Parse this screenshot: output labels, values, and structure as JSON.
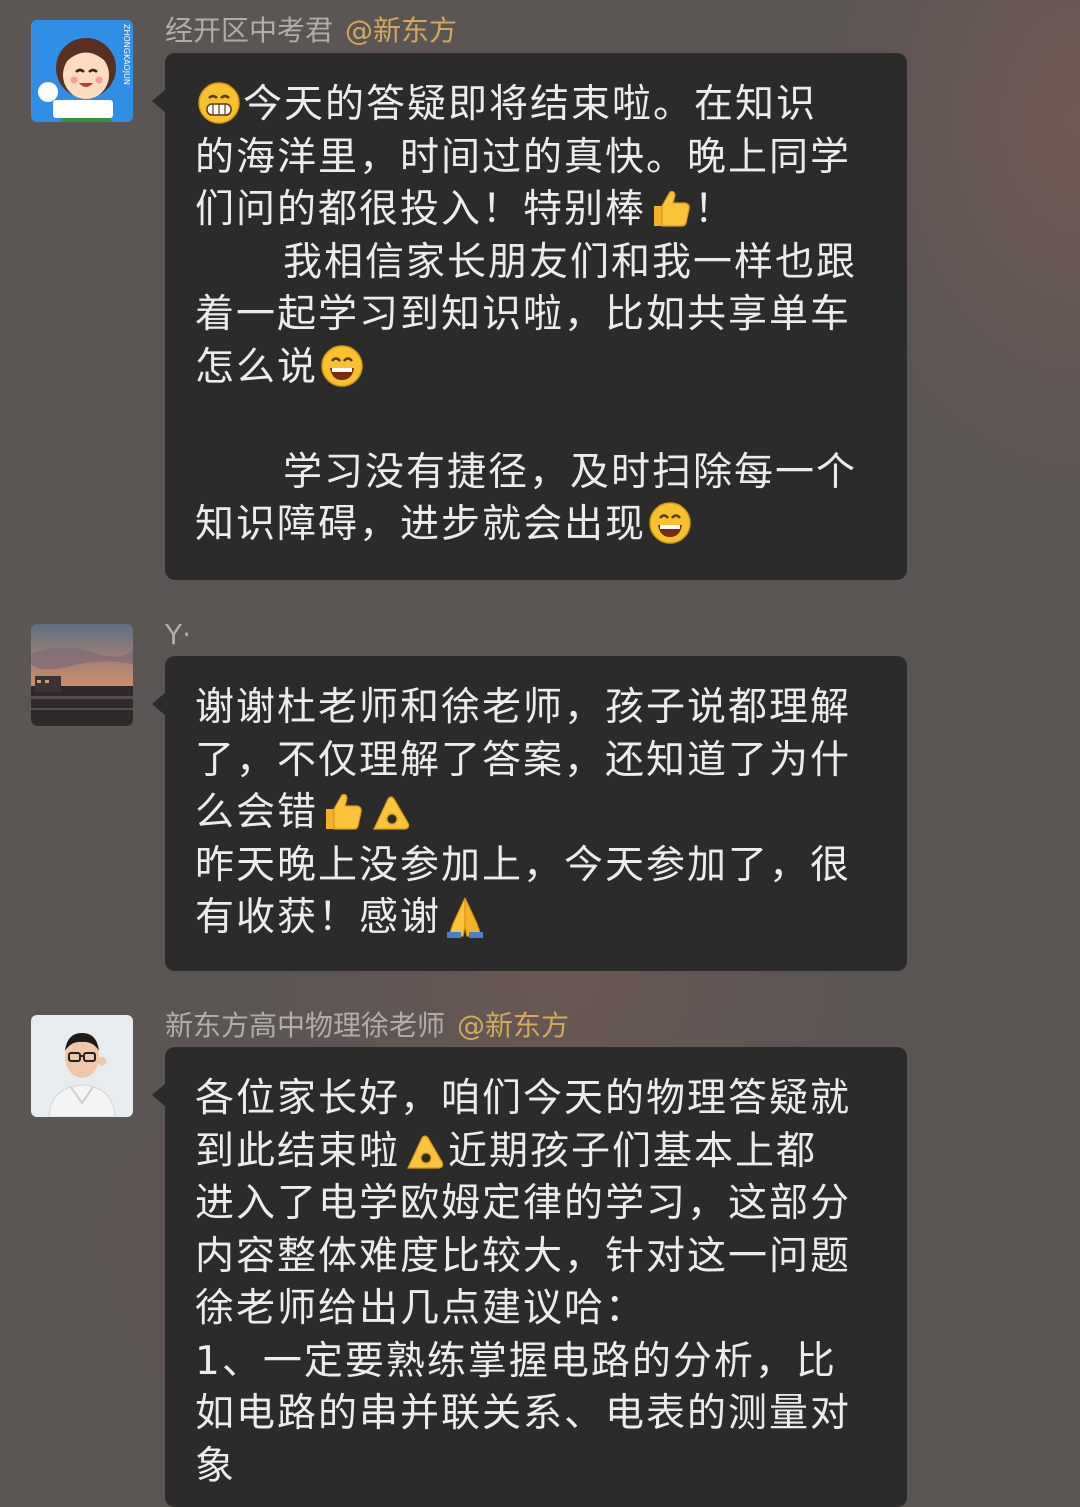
{
  "messages": [
    {
      "sender": "经开区中考君",
      "org": "@新东方",
      "avatar_text": "ZHONGKAOJUN",
      "lines": [
        "今天的答疑即将结束啦。在知识",
        "的海洋里，时间过的真快。晚上同学",
        "们问的都很投入！特别棒",
        "我相信家长朋友们和我一样也跟",
        "着一起学习到知识啦，比如共享单车",
        "怎么说",
        "",
        "学习没有捷径，及时扫除每一个",
        "知识障碍，进步就会出现"
      ],
      "line3_tail": "！"
    },
    {
      "sender": "Y·",
      "lines": [
        "谢谢杜老师和徐老师，孩子说都理解",
        "了，不仅理解了答案，还知道了为什",
        "么会错",
        "昨天晚上没参加上，今天参加了，很",
        "有收获！感谢"
      ]
    },
    {
      "sender": "新东方高中物理徐老师",
      "org": "@新东方",
      "lines": [
        "各位家长好，咱们今天的物理答疑就",
        "到此结束啦",
        "近期孩子们基本上都",
        "进入了电学欧姆定律的学习，这部分",
        "内容整体难度比较大，针对这一问题",
        "徐老师给出几点建议哈：",
        "1、一定要熟练掌握电路的分析，比",
        "如电路的串并联关系、电表的测量对",
        "象"
      ]
    }
  ],
  "icons": {
    "grin": "grin-emoji-icon",
    "thumbs_up": "thumbs-up-emoji-icon",
    "smile": "smile-emoji-icon",
    "ok_hand": "ok-hand-emoji-icon",
    "pray": "folded-hands-emoji-icon"
  },
  "colors": {
    "background": "#5b5554",
    "bubble": "#2b2b2b",
    "text": "#ececec",
    "sender": "#b2acaa",
    "org_tag": "#d4a85a"
  }
}
